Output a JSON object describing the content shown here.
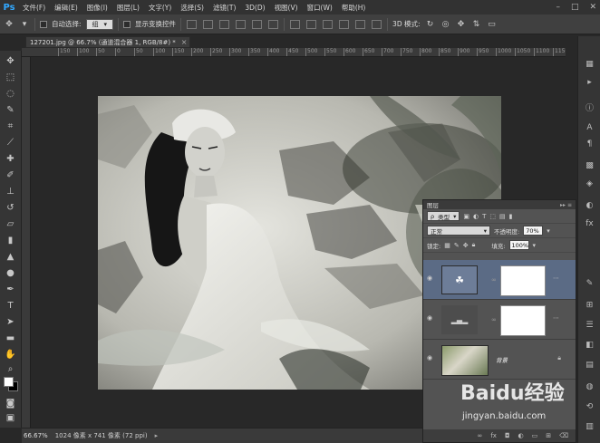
{
  "app": {
    "logo": "Ps"
  },
  "menu": [
    "文件(F)",
    "编辑(E)",
    "图像(I)",
    "图层(L)",
    "文字(Y)",
    "选择(S)",
    "滤镜(T)",
    "3D(D)",
    "视图(V)",
    "窗口(W)",
    "帮助(H)"
  ],
  "options": {
    "auto_select_label": "自动选择:",
    "auto_select_value": "组",
    "show_transform_label": "显示变换控件",
    "mode_3d_label": "3D 模式:"
  },
  "document": {
    "tab_title": "127201.jpg @ 66.7% (通道混合器 1, RGB/8#) *",
    "close_glyph": "×"
  },
  "ruler_top_ticks": [
    "150",
    "100",
    "50",
    "0",
    "50",
    "100",
    "150",
    "200",
    "250",
    "300",
    "350",
    "400",
    "450",
    "500",
    "550",
    "600",
    "650",
    "700",
    "750",
    "800",
    "850",
    "900",
    "950",
    "1000",
    "1050",
    "1100",
    "1150",
    "1200"
  ],
  "layers_panel": {
    "title": "图层",
    "filter_kind": "类型",
    "blend_mode": "正常",
    "opacity_label": "不透明度:",
    "opacity_value": "70%",
    "lock_label": "锁定:",
    "fill_label": "填充:",
    "fill_value": "100%",
    "background_layer_name": "背景"
  },
  "status": {
    "zoom": "66.67%",
    "doc_size": "1024 像素 x 741 像素 (72 ppi)"
  },
  "watermark": {
    "main": "Baidu经验",
    "sub": "jingyan.baidu.com"
  },
  "colors": {
    "accent": "#31a8ff",
    "panel_bg": "#535353",
    "selected_layer": "#5b6b85"
  }
}
